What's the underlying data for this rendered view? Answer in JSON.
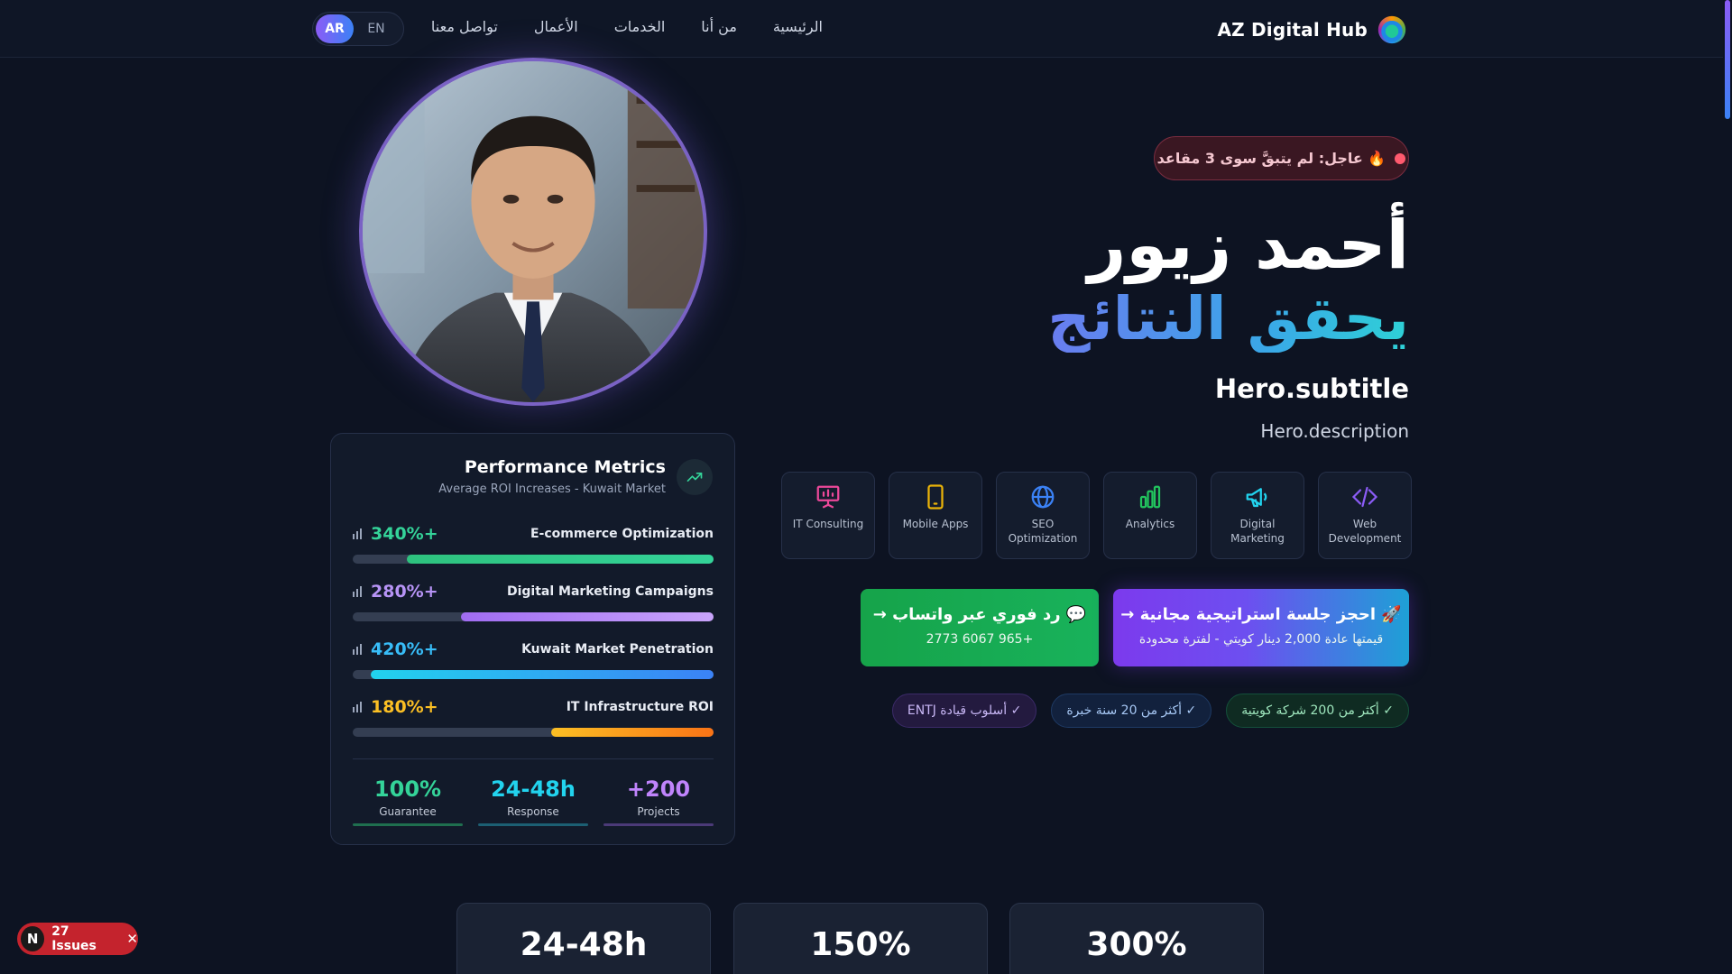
{
  "brand": {
    "name": "AZ Digital Hub",
    "logo_icon": "globe-logo-icon"
  },
  "nav": {
    "links": [
      "الرئيسية",
      "من أنا",
      "الخدمات",
      "الأعمال",
      "تواصل معنا"
    ],
    "lang_active": "AR",
    "lang_other": "EN"
  },
  "hero": {
    "urgent": "🔥 عاجل: لم يتبقَّ سوى 3 مقاعد",
    "name": "أحمد زيور",
    "tagline": "يحقق النتائج",
    "subtitle": "Hero.subtitle",
    "description": "Hero.description",
    "services": [
      {
        "label": "Web Development",
        "icon": "code-icon",
        "color": "#8b5cf6"
      },
      {
        "label": "Digital Marketing",
        "icon": "megaphone-icon",
        "color": "#22d3ee"
      },
      {
        "label": "Analytics",
        "icon": "bar-chart-icon",
        "color": "#22c55e"
      },
      {
        "label": "SEO Optimization",
        "icon": "globe-icon",
        "color": "#3b82f6"
      },
      {
        "label": "Mobile Apps",
        "icon": "smartphone-icon",
        "color": "#eab308"
      },
      {
        "label": "IT Consulting",
        "icon": "presentation-icon",
        "color": "#ec4899"
      }
    ],
    "cta_book": {
      "title": "🚀 احجز جلسة استراتيجية مجانية →",
      "sub": "قيمتها عادة 2,000 دينار كويتي - لفترة محدودة"
    },
    "cta_whatsapp": {
      "title": "💬 رد فوري عبر واتساب →",
      "sub": "+965 6067 2773"
    },
    "badges": [
      "✓ أكثر من 200 شركة كويتية",
      "✓ أكثر من 20 سنة خبرة",
      "✓ أسلوب قيادة ENTJ"
    ]
  },
  "performance": {
    "title": "Performance Metrics",
    "subtitle": "Average ROI Increases - Kuwait Market",
    "metrics": [
      {
        "value": "340%+",
        "label": "E-commerce Optimization",
        "percent": 85,
        "color": "#34d399",
        "fill": "linear-gradient(90deg,#2ec27e,#34d399)"
      },
      {
        "value": "280%+",
        "label": "Digital Marketing Campaigns",
        "percent": 70,
        "color": "#b794f6",
        "fill": "linear-gradient(90deg,#a06cf2,#c9a4fb)"
      },
      {
        "value": "420%+",
        "label": "Kuwait Market Penetration",
        "percent": 95,
        "color": "#38bdf8",
        "fill": "linear-gradient(90deg,#22d3ee,#3b82f6)"
      },
      {
        "value": "180%+",
        "label": "IT Infrastructure ROI",
        "percent": 45,
        "color": "#fbbf24",
        "fill": "linear-gradient(90deg,#fbbf24,#f97316)"
      }
    ],
    "stats": [
      {
        "value": "100%",
        "label": "Guarantee",
        "color": "#34d399"
      },
      {
        "value": "24-48h",
        "label": "Response",
        "color": "#22d3ee"
      },
      {
        "value": "+200",
        "label": "Projects",
        "color": "#c084fc"
      }
    ]
  },
  "bottom_stats": [
    "24-48h",
    "150%",
    "300%"
  ],
  "issues": {
    "letter": "N",
    "label": "27 Issues"
  }
}
